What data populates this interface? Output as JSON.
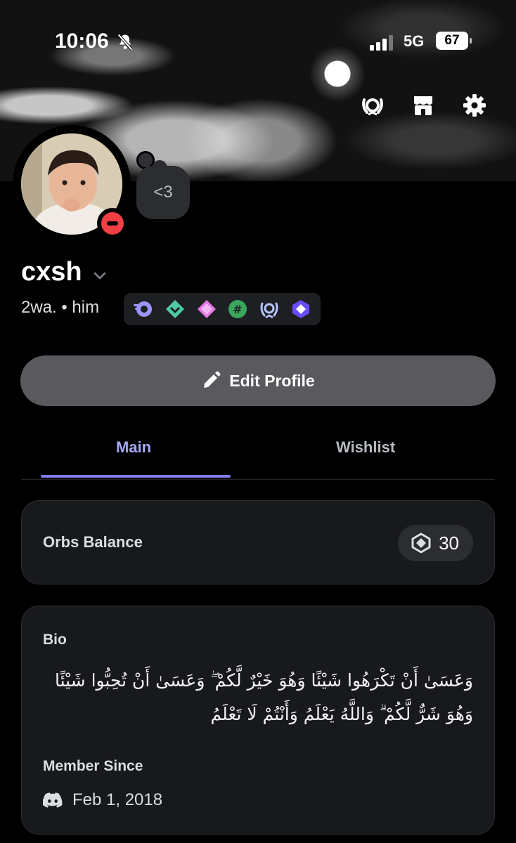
{
  "status_bar": {
    "time": "10:06",
    "network": "5G",
    "battery": "67"
  },
  "profile": {
    "username": "cxsh",
    "pronoun_line": "2wa. • him",
    "custom_status": "<3"
  },
  "actions": {
    "edit_profile": "Edit Profile"
  },
  "tabs": [
    {
      "label": "Main"
    },
    {
      "label": "Wishlist"
    }
  ],
  "orbs": {
    "label": "Orbs Balance",
    "value": "30"
  },
  "bio": {
    "title": "Bio",
    "text": "وَعَسَىٰ أَنْ تَكْرَهُوا شَيْئًا وَهُوَ خَيْرٌ لَّكُمْ ۖ وَعَسَىٰ أَنْ تُحِبُّوا شَيْئًا وَهُوَ شَرٌّ لَّكُمْ ۗ وَاللَّهُ يَعْلَمُ وَأَنْتُمْ لَا تَعْلَمُ"
  },
  "member_since": {
    "title": "Member Since",
    "date": "Feb 1, 2018"
  },
  "colors": {
    "accent": "#7f7cf0",
    "dnd": "#f23f43",
    "card": "#18191c",
    "edit_button": "#5a5a5e"
  }
}
